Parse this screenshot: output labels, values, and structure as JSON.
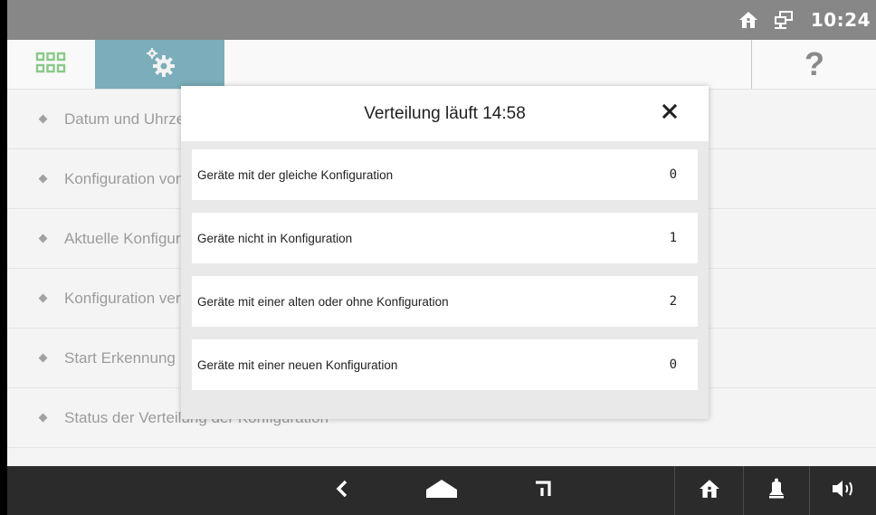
{
  "status_bar": {
    "time": "10:24",
    "icons": [
      "home-icon",
      "network-icon"
    ]
  },
  "header": {
    "apps_icon": "grid-icon",
    "settings_icon": "gears-icon",
    "help_label": "?",
    "colors": {
      "settings_tab": "#0f6b82",
      "apps_icon": "#2a9d2a"
    }
  },
  "menu": {
    "items": [
      {
        "label": "Datum und Uhrzeit"
      },
      {
        "label": "Konfiguration von Datei"
      },
      {
        "label": "Aktuelle Konfiguration"
      },
      {
        "label": "Konfiguration verteilen"
      },
      {
        "label": "Start Erkennung"
      },
      {
        "label": "Status der Verteilung der Konfiguration"
      }
    ]
  },
  "dialog": {
    "title": "Verteilung läuft 14:58",
    "close_icon": "close-icon",
    "rows": [
      {
        "label": "Geräte mit der gleiche Konfiguration",
        "value": "0"
      },
      {
        "label": "Geräte nicht in Konfiguration",
        "value": "1"
      },
      {
        "label": "Geräte mit einer alten oder ohne Konfiguration",
        "value": "2"
      },
      {
        "label": "Geräte mit einer neuen Konfiguration",
        "value": "0"
      }
    ]
  },
  "nav_bar": {
    "buttons": [
      "back-icon",
      "home-shape-icon",
      "recent-apps-icon",
      "home-icon",
      "bell-icon",
      "speaker-icon"
    ]
  }
}
